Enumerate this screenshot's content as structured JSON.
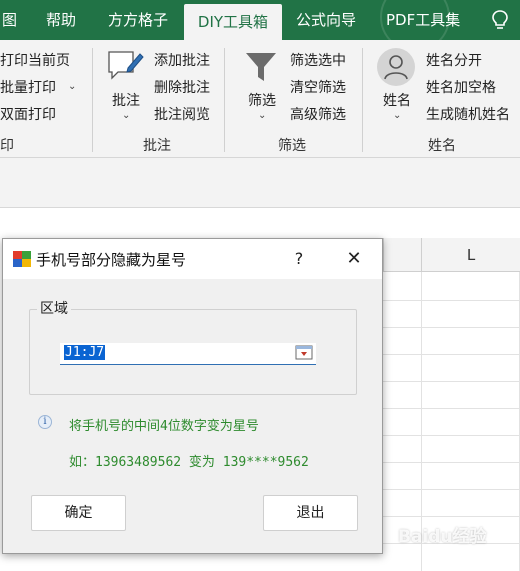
{
  "ribbon": {
    "tabs": [
      {
        "label": "图",
        "active": false
      },
      {
        "label": "帮助",
        "active": false
      },
      {
        "label": "方方格子",
        "active": false
      },
      {
        "label": "DIY工具箱",
        "active": true
      },
      {
        "label": "公式向导",
        "active": false
      },
      {
        "label": "PDF工具集",
        "active": false
      }
    ],
    "print_group": {
      "items": [
        "打印当前页",
        "批量打印",
        "双面打印"
      ],
      "label": "印"
    },
    "comment_group": {
      "big_button": "批注",
      "items": [
        "添加批注",
        "删除批注",
        "批注阅览"
      ],
      "label": "批注"
    },
    "filter_group": {
      "big_button": "筛选",
      "items": [
        "筛选选中",
        "清空筛选",
        "高级筛选"
      ],
      "label": "筛选"
    },
    "name_group": {
      "big_button": "姓名",
      "items": [
        "姓名分开",
        "姓名加空格",
        "生成随机姓名"
      ],
      "label": "姓名"
    }
  },
  "sheet": {
    "visible_column": "L"
  },
  "dialog": {
    "title": "手机号部分隐藏为星号",
    "help": "?",
    "close": "✕",
    "group_label": "区域",
    "range_value": "J1:J7",
    "info": "将手机号的中间4位数字变为星号",
    "example": "如：13963489562 变为 139****9562",
    "ok_label": "确定",
    "exit_label": "退出"
  },
  "watermark": "Baidu经验",
  "colors": {
    "ribbon_green": "#217346",
    "hint_green": "#2e8b2e",
    "selection_blue": "#0a64d2"
  }
}
